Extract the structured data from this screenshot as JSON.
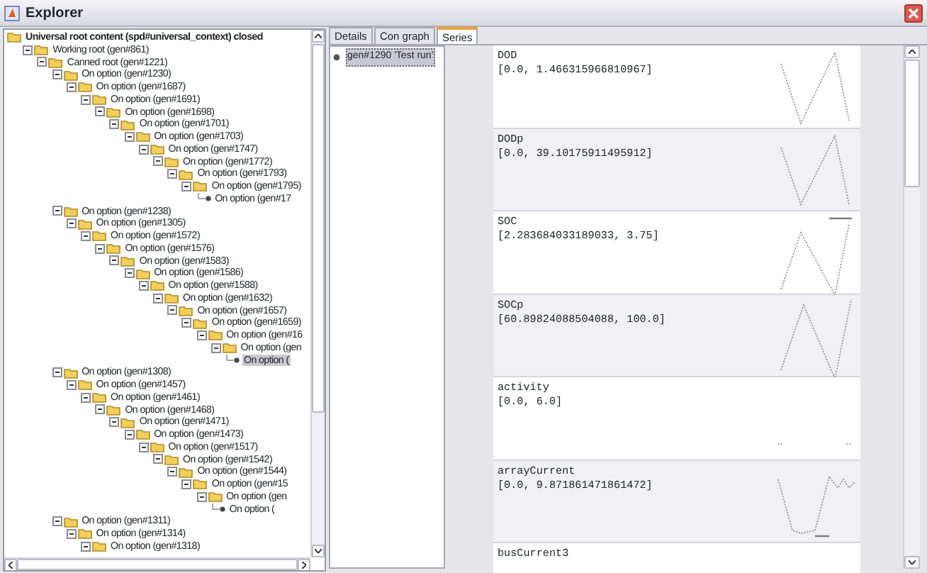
{
  "window": {
    "title": "Explorer"
  },
  "tree": [
    {
      "label": "Universal root content (spd#universal_context) closed",
      "kind": "folder",
      "selected": false,
      "children": [
        {
          "label": "Working root (gen#861)",
          "kind": "folder",
          "expanded": true,
          "selected": false,
          "children": [
            {
              "label": "Canned root (gen#1221)",
              "kind": "folder",
              "expanded": true,
              "selected": false,
              "children": [
                {
                  "label": "On option (gen#1230)",
                  "kind": "folder",
                  "expanded": true,
                  "selected": false,
                  "children": [
                    {
                      "label": "On option (gen#1687)",
                      "kind": "folder",
                      "expanded": true,
                      "selected": false,
                      "children": [
                        {
                          "label": "On option (gen#1691)",
                          "kind": "folder",
                          "expanded": true,
                          "selected": false,
                          "children": [
                            {
                              "label": "On option (gen#1698)",
                              "kind": "folder",
                              "expanded": true,
                              "selected": false,
                              "children": [
                                {
                                  "label": "On option (gen#1701)",
                                  "kind": "folder",
                                  "expanded": true,
                                  "selected": false,
                                  "children": [
                                    {
                                      "label": "On option (gen#1703)",
                                      "kind": "folder",
                                      "expanded": true,
                                      "selected": false,
                                      "children": [
                                        {
                                          "label": "On option (gen#1747)",
                                          "kind": "folder",
                                          "expanded": true,
                                          "selected": false,
                                          "children": [
                                            {
                                              "label": "On option (gen#1772)",
                                              "kind": "folder",
                                              "expanded": true,
                                              "selected": false,
                                              "children": [
                                                {
                                                  "label": "On option (gen#1793)",
                                                  "kind": "folder",
                                                  "expanded": true,
                                                  "selected": false,
                                                  "children": [
                                                    {
                                                      "label": "On option (gen#1795)",
                                                      "kind": "folder",
                                                      "expanded": true,
                                                      "selected": false,
                                                      "children": [
                                                        {
                                                          "label": "On option (gen#17",
                                                          "kind": "leaf",
                                                          "selected": false
                                                        }
                                                      ]
                                                    }
                                                  ]
                                                }
                                              ]
                                            }
                                          ]
                                        }
                                      ]
                                    }
                                  ]
                                }
                              ]
                            }
                          ]
                        }
                      ]
                    }
                  ]
                },
                {
                  "label": "On option (gen#1238)",
                  "kind": "folder",
                  "expanded": true,
                  "selected": false,
                  "children": [
                    {
                      "label": "On option (gen#1305)",
                      "kind": "folder",
                      "expanded": true,
                      "selected": false,
                      "children": [
                        {
                          "label": "On option (gen#1572)",
                          "kind": "folder",
                          "expanded": true,
                          "selected": false,
                          "children": [
                            {
                              "label": "On option (gen#1576)",
                              "kind": "folder",
                              "expanded": true,
                              "selected": false,
                              "children": [
                                {
                                  "label": "On option (gen#1583)",
                                  "kind": "folder",
                                  "expanded": true,
                                  "selected": false,
                                  "children": [
                                    {
                                      "label": "On option (gen#1586)",
                                      "kind": "folder",
                                      "expanded": true,
                                      "selected": false,
                                      "children": [
                                        {
                                          "label": "On option (gen#1588)",
                                          "kind": "folder",
                                          "expanded": true,
                                          "selected": false,
                                          "children": [
                                            {
                                              "label": "On option (gen#1632)",
                                              "kind": "folder",
                                              "expanded": true,
                                              "selected": false,
                                              "children": [
                                                {
                                                  "label": "On option (gen#1657)",
                                                  "kind": "folder",
                                                  "expanded": true,
                                                  "selected": false,
                                                  "children": [
                                                    {
                                                      "label": "On option (gen#1659)",
                                                      "kind": "folder",
                                                      "expanded": true,
                                                      "selected": false,
                                                      "children": [
                                                        {
                                                          "label": "On option (gen#16",
                                                          "kind": "folder",
                                                          "expanded": true,
                                                          "selected": false,
                                                          "children": [
                                                            {
                                                              "label": "On option (gen",
                                                              "kind": "folder",
                                                              "expanded": true,
                                                              "selected": false,
                                                              "children": [
                                                                {
                                                                  "label": "On option (",
                                                                  "kind": "leaf",
                                                                  "selected": true
                                                                }
                                                              ]
                                                            }
                                                          ]
                                                        }
                                                      ]
                                                    }
                                                  ]
                                                }
                                              ]
                                            }
                                          ]
                                        }
                                      ]
                                    }
                                  ]
                                }
                              ]
                            }
                          ]
                        }
                      ]
                    }
                  ]
                },
                {
                  "label": "On option (gen#1308)",
                  "kind": "folder",
                  "expanded": true,
                  "selected": false,
                  "children": [
                    {
                      "label": "On option (gen#1457)",
                      "kind": "folder",
                      "expanded": true,
                      "selected": false,
                      "children": [
                        {
                          "label": "On option (gen#1461)",
                          "kind": "folder",
                          "expanded": true,
                          "selected": false,
                          "children": [
                            {
                              "label": "On option (gen#1468)",
                              "kind": "folder",
                              "expanded": true,
                              "selected": false,
                              "children": [
                                {
                                  "label": "On option (gen#1471)",
                                  "kind": "folder",
                                  "expanded": true,
                                  "selected": false,
                                  "children": [
                                    {
                                      "label": "On option (gen#1473)",
                                      "kind": "folder",
                                      "expanded": true,
                                      "selected": false,
                                      "children": [
                                        {
                                          "label": "On option (gen#1517)",
                                          "kind": "folder",
                                          "expanded": true,
                                          "selected": false,
                                          "children": [
                                            {
                                              "label": "On option (gen#1542)",
                                              "kind": "folder",
                                              "expanded": true,
                                              "selected": false,
                                              "children": [
                                                {
                                                  "label": "On option (gen#1544)",
                                                  "kind": "folder",
                                                  "expanded": true,
                                                  "selected": false,
                                                  "children": [
                                                    {
                                                      "label": "On option (gen#15",
                                                      "kind": "folder",
                                                      "expanded": true,
                                                      "selected": false,
                                                      "children": [
                                                        {
                                                          "label": "On option (gen",
                                                          "kind": "folder",
                                                          "expanded": true,
                                                          "selected": false,
                                                          "children": [
                                                            {
                                                              "label": "On option (",
                                                              "kind": "leaf",
                                                              "selected": false
                                                            }
                                                          ]
                                                        }
                                                      ]
                                                    }
                                                  ]
                                                }
                                              ]
                                            }
                                          ]
                                        }
                                      ]
                                    }
                                  ]
                                }
                              ]
                            }
                          ]
                        }
                      ]
                    }
                  ]
                },
                {
                  "label": "On option (gen#1311)",
                  "kind": "folder",
                  "expanded": true,
                  "selected": false,
                  "children": [
                    {
                      "label": "On option (gen#1314)",
                      "kind": "folder",
                      "expanded": true,
                      "selected": false,
                      "children": [
                        {
                          "label": "On option (gen#1318)",
                          "kind": "folder",
                          "expanded": true,
                          "selected": false
                        }
                      ]
                    }
                  ]
                }
              ]
            }
          ]
        }
      ]
    }
  ],
  "tabs": [
    {
      "label": "Details",
      "selected": false
    },
    {
      "label": "Con graph",
      "selected": false
    },
    {
      "label": "Series",
      "selected": true
    }
  ],
  "runs": [
    {
      "label": "gen#1290 'Test run'",
      "selected": true
    }
  ],
  "series": [
    {
      "name": "DOD",
      "range": "[0.0, 1.466315966810967]"
    },
    {
      "name": "DODp",
      "range": "[0.0, 39.10175911495912]"
    },
    {
      "name": "SOC",
      "range": "[2.283684033189033, 3.75]"
    },
    {
      "name": "SOCp",
      "range": "[60.89824088504088, 100.0]"
    },
    {
      "name": "activity",
      "range": "[0.0, 6.0]"
    },
    {
      "name": "arrayCurrent",
      "range": "[0.0, 9.871861471861472]"
    },
    {
      "name": "busCurrent3"
    }
  ]
}
